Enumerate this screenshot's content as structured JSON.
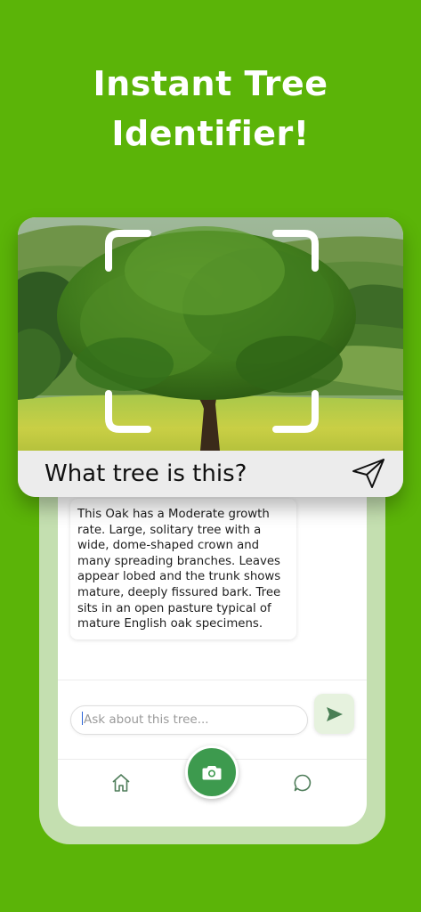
{
  "headline": {
    "line1": "Instant Tree",
    "line2": "Identifier!"
  },
  "card": {
    "photo_subject": "oak tree in pasture",
    "question": "What tree is this?",
    "send_icon": "paper-plane-icon"
  },
  "chat": {
    "answer": "This Oak has a Moderate growth rate. Large, solitary tree with a wide, dome-shaped crown and many spreading branches. Leaves appear lobed and the trunk shows mature, deeply fissured bark. Tree sits in an open pasture typical of mature English oak specimens."
  },
  "composer": {
    "placeholder": "Ask about this tree...",
    "send_icon": "send-arrow-icon"
  },
  "bottom_nav": {
    "home_icon": "home-icon",
    "camera_icon": "camera-icon",
    "chat_icon": "chat-bubble-icon"
  },
  "colors": {
    "background": "#5bb408",
    "accent_green": "#3d9a4e",
    "phone_frame": "#c4dfb0",
    "send_button_bg": "#e6f2de"
  }
}
